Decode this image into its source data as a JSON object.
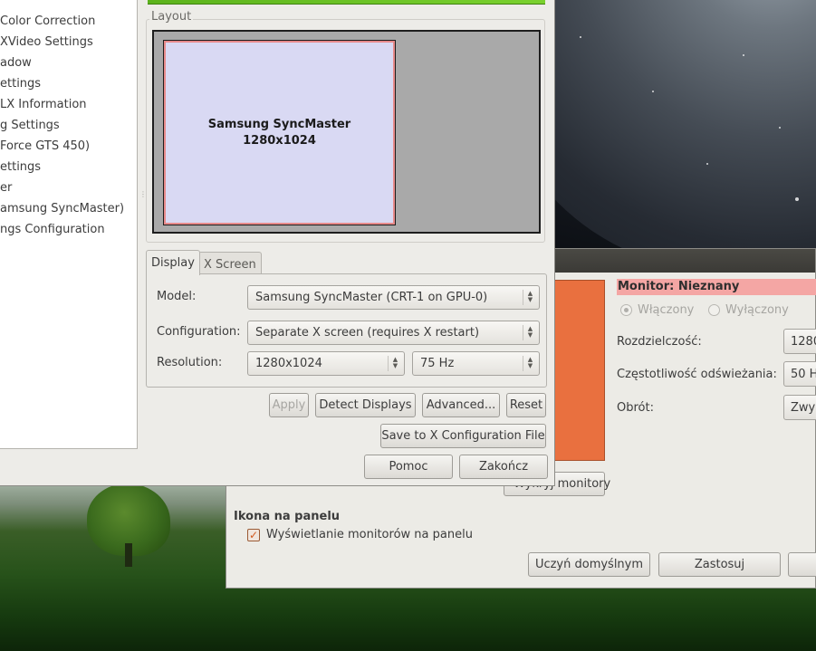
{
  "nvidia_window": {
    "tree_items": [
      "Color Correction",
      "XVideo Settings",
      "adow",
      "ettings",
      "LX Information",
      "g Settings",
      "Force GTS 450)",
      "ettings",
      "er",
      "amsung SyncMaster)",
      "ngs Configuration"
    ],
    "layout": {
      "title": "Layout",
      "screen_name": "Samsung SyncMaster",
      "screen_resolution": "1280x1024"
    },
    "tabs": [
      {
        "label": "Display",
        "active": true
      },
      {
        "label": "X Screen",
        "active": false
      }
    ],
    "fields": {
      "model_label": "Model:",
      "model_value": "Samsung SyncMaster (CRT-1 on GPU-0)",
      "configuration_label": "Configuration:",
      "configuration_value": "Separate X screen (requires X restart)",
      "resolution_label": "Resolution:",
      "resolution_value": "1280x1024",
      "refresh_value": "75 Hz"
    },
    "buttons": {
      "apply": "Apply",
      "detect": "Detect Displays",
      "advanced": "Advanced...",
      "reset": "Reset",
      "save_x": "Save to X Configuration File",
      "help": "Pomoc",
      "quit": "Zakończ"
    }
  },
  "monitor_window": {
    "monitor_heading": "Monitor: Nieznany",
    "on_label": "Włączony",
    "off_label": "Wyłączony",
    "resolution_label": "Rozdzielczość:",
    "resolution_value": "1280",
    "refresh_label": "Częstotliwość odświeżania:",
    "refresh_value": "50 H",
    "rotation_label": "Obrót:",
    "rotation_value": "Zwyk",
    "detect_button": "Wykryj monitory",
    "panel_section": "Ikona na panelu",
    "panel_checkbox": "Wyświetlanie monitorów na panelu",
    "default_button": "Uczyń domyślnym",
    "apply_button": "Zastosuj"
  },
  "colors": {
    "accent_orange": "#e9703f",
    "monitor_heading_bg": "#f4a6a4",
    "screen_fill": "#d9d9f3",
    "nvidia_green": "#76b900"
  }
}
